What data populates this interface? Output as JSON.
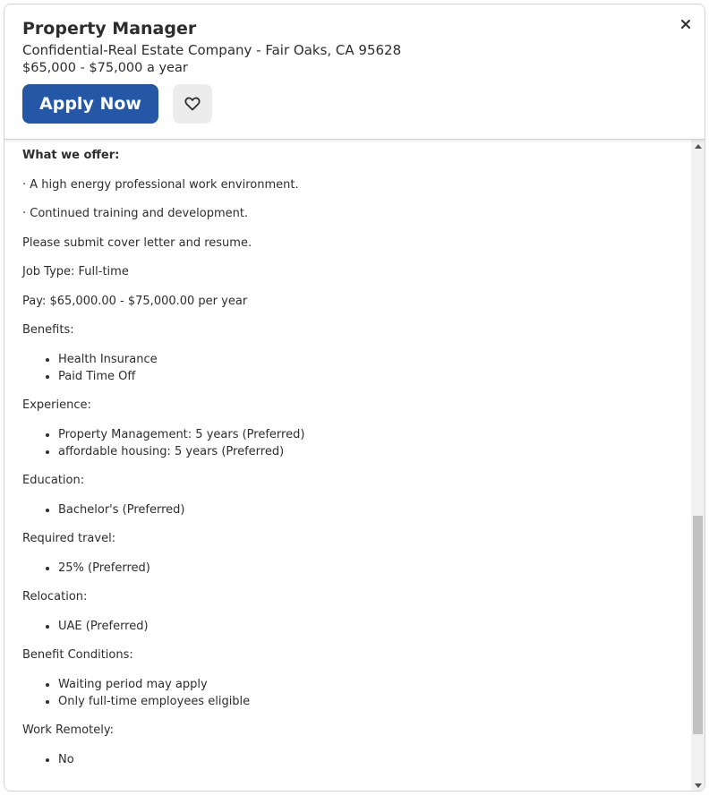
{
  "header": {
    "title": "Property Manager",
    "company_location": "Confidential-Real Estate Company - Fair Oaks, CA 95628",
    "salary": "$65,000 - $75,000 a year",
    "apply_label": "Apply Now",
    "close_symbol": "×"
  },
  "colors": {
    "apply_button": "#2557a7",
    "save_button_bg": "#ececec",
    "text": "#2d2d2d"
  },
  "description": {
    "offer_heading": "What we offer:",
    "offer_items": [
      "· A high energy professional work environment.",
      "· Continued training and development."
    ],
    "submit_note": "Please submit cover letter and resume.",
    "job_type": "Job Type: Full-time",
    "pay": "Pay: $65,000.00 - $75,000.00 per year",
    "benefits": {
      "label": "Benefits:",
      "items": [
        "Health Insurance",
        "Paid Time Off"
      ]
    },
    "experience": {
      "label": "Experience:",
      "items": [
        "Property Management: 5 years (Preferred)",
        "affordable housing: 5 years (Preferred)"
      ]
    },
    "education": {
      "label": "Education:",
      "items": [
        "Bachelor's (Preferred)"
      ]
    },
    "travel": {
      "label": "Required travel:",
      "items": [
        "25% (Preferred)"
      ]
    },
    "relocation": {
      "label": "Relocation:",
      "items": [
        "UAE (Preferred)"
      ]
    },
    "benefit_conditions": {
      "label": "Benefit Conditions:",
      "items": [
        "Waiting period may apply",
        "Only full-time employees eligible"
      ]
    },
    "remote": {
      "label": "Work Remotely:",
      "items": [
        "No"
      ]
    }
  },
  "icons": {
    "save": "heart-icon",
    "close": "close-icon",
    "scroll_up": "triangle-up-icon",
    "scroll_down": "triangle-down-icon"
  }
}
